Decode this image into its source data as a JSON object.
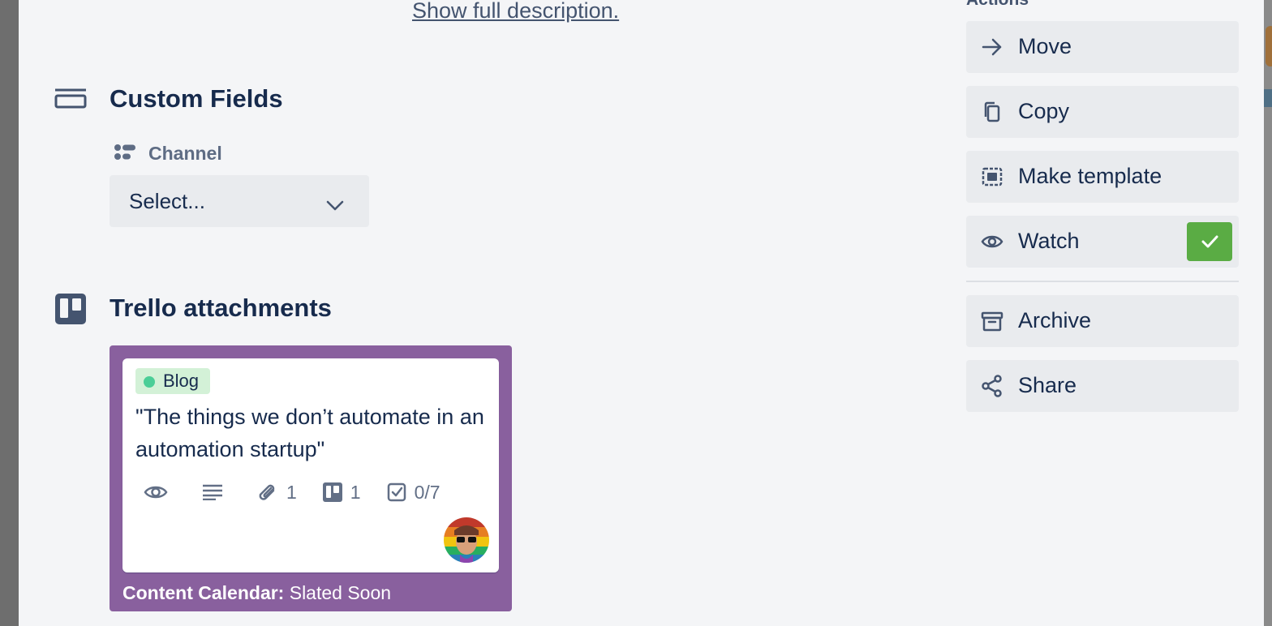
{
  "description": {
    "show_full_label": "Show full description."
  },
  "custom_fields": {
    "title": "Custom Fields",
    "field_label": "Channel",
    "select_value": "Select..."
  },
  "attachments": {
    "title": "Trello attachments",
    "card": {
      "label": "Blog",
      "title": "\"The things we don’t automate in an automation startup\"",
      "attachments_count": "1",
      "linked_cards_count": "1",
      "checklist": "0/7",
      "board_name": "Content Calendar:",
      "list_name": "Slated Soon"
    }
  },
  "actions": {
    "title": "Actions",
    "move": "Move",
    "copy": "Copy",
    "make_template": "Make template",
    "watch": "Watch",
    "archive": "Archive",
    "share": "Share"
  },
  "colors": {
    "card_border": "#89609e",
    "label_bg": "#d3f1d7",
    "label_dot": "#4bce97",
    "watch_check": "#5aac44",
    "button_bg": "#e9ebee"
  }
}
